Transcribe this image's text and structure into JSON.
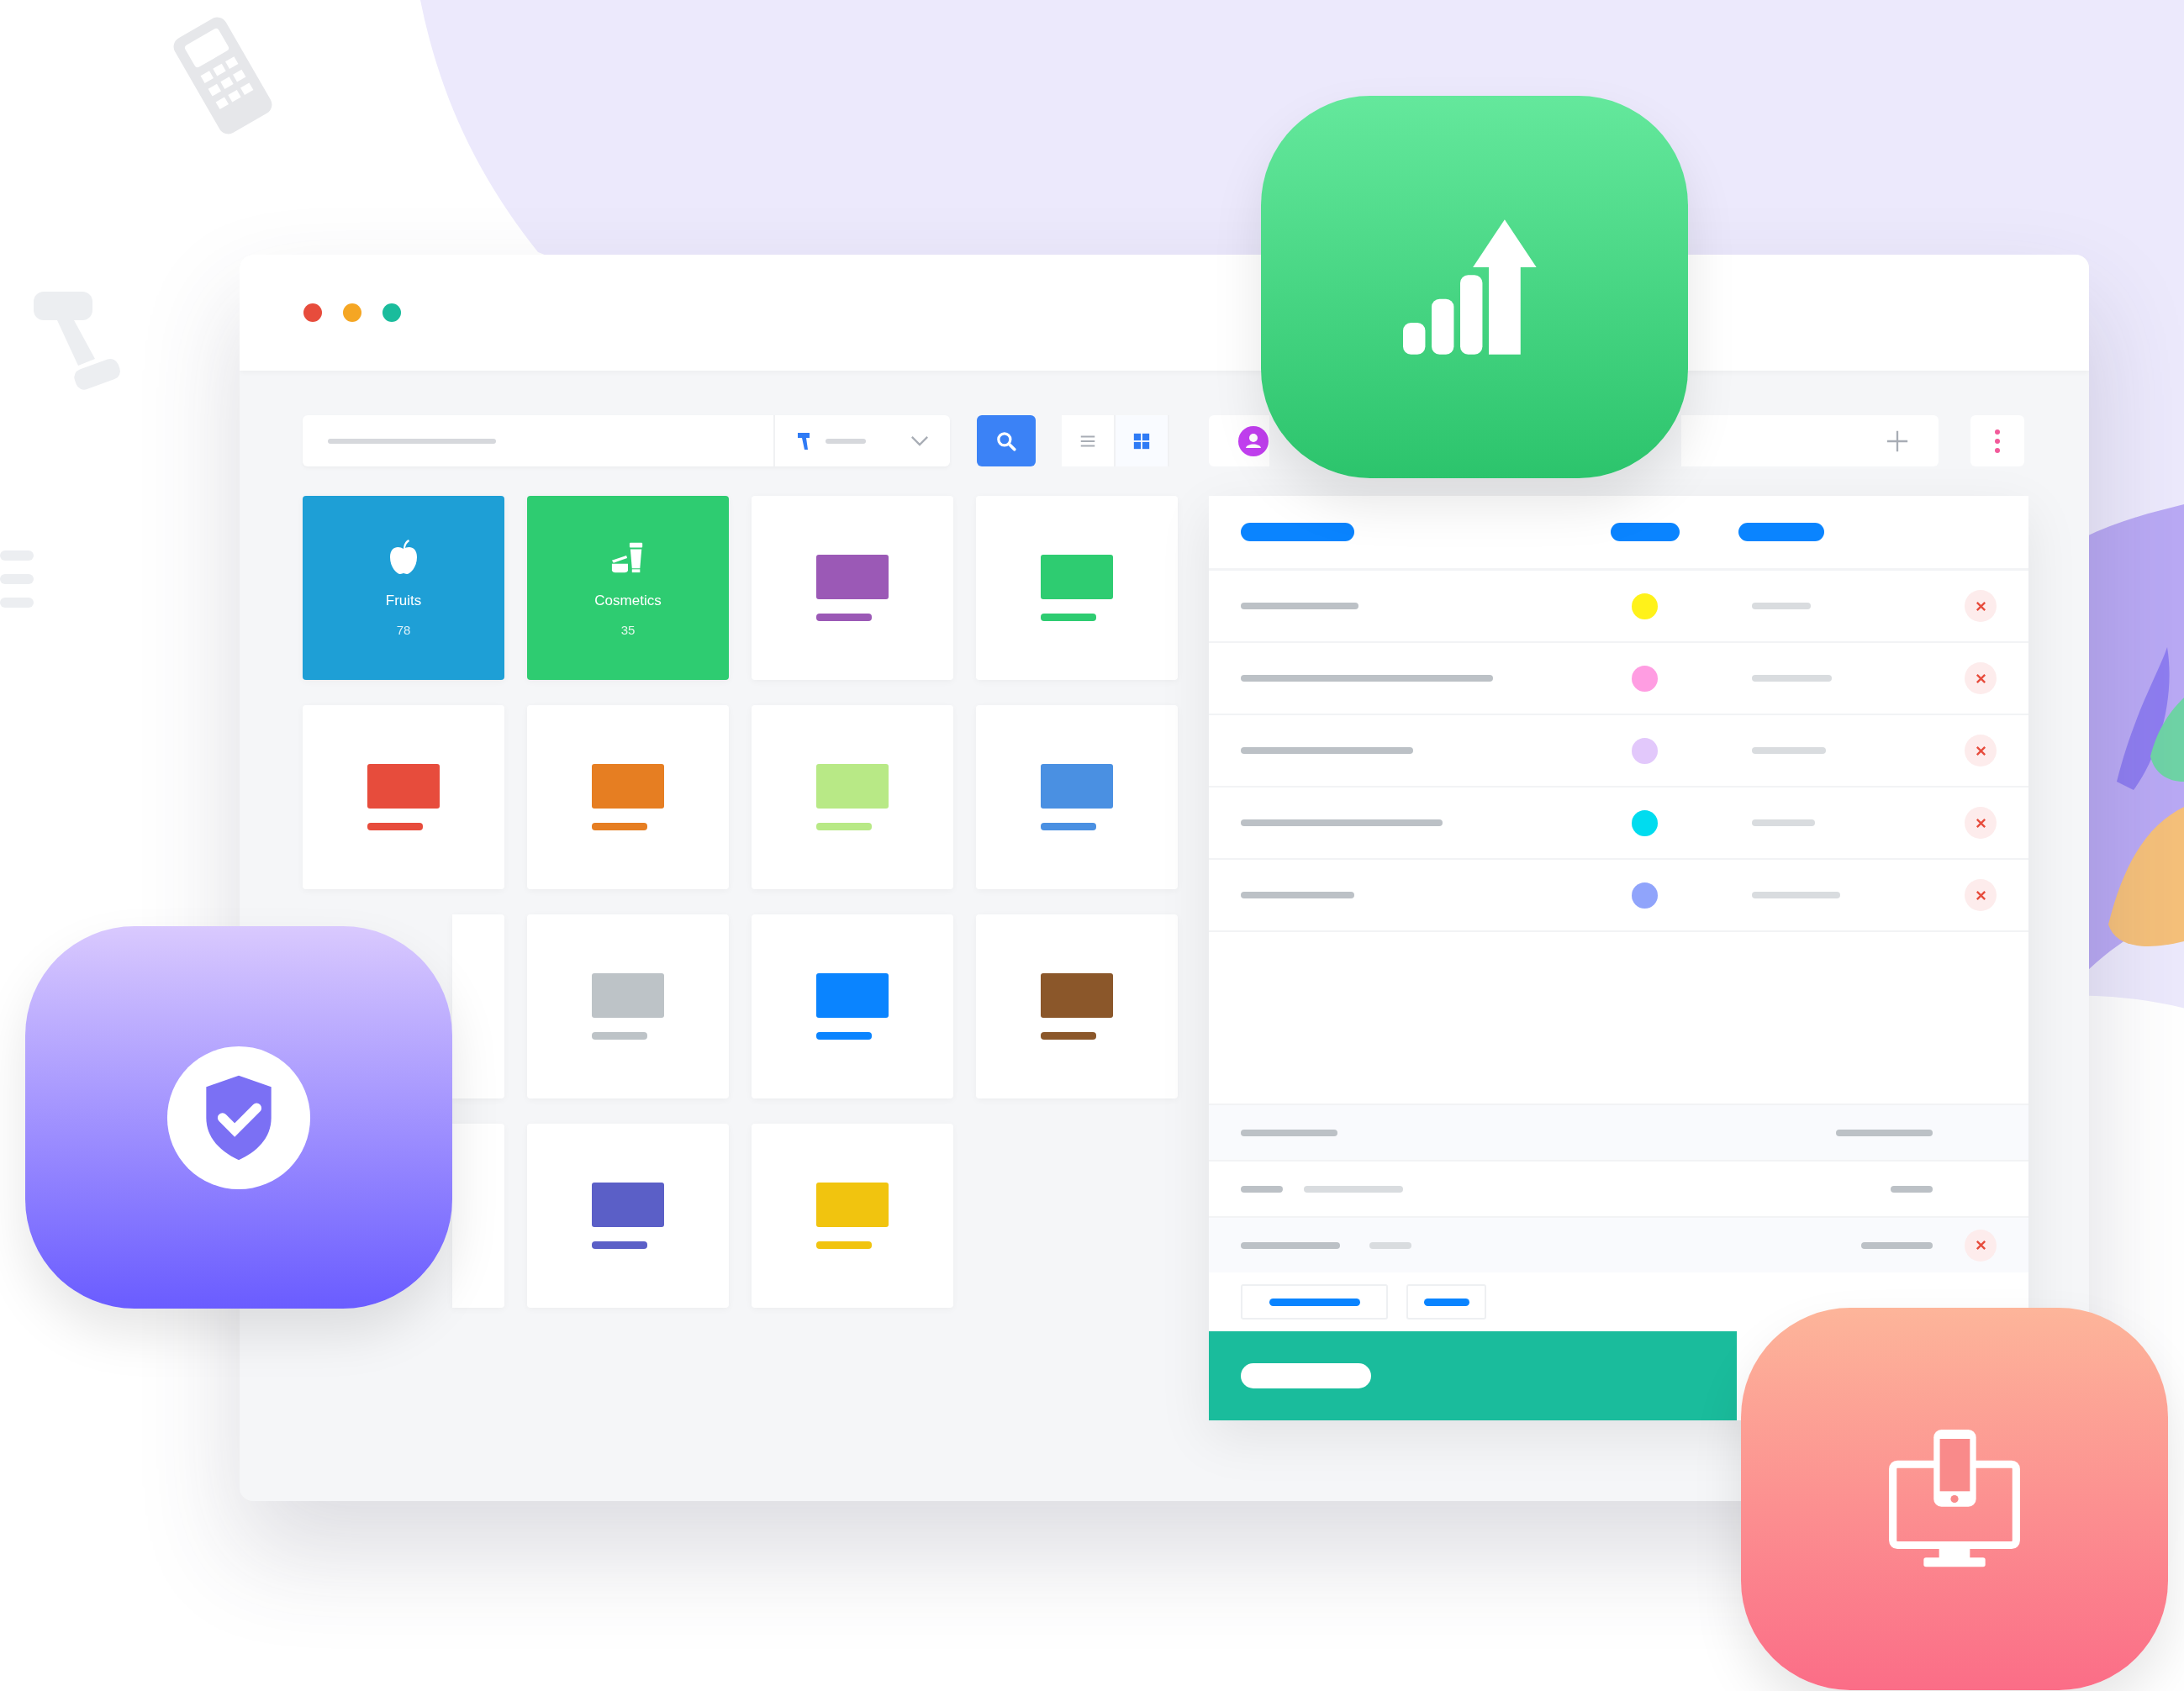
{
  "window": {
    "traffic_lights": [
      {
        "color": "#e74c3c"
      },
      {
        "color": "#f5a623"
      },
      {
        "color": "#1abc9c"
      }
    ]
  },
  "toolbar": {
    "view_modes": [
      {
        "kind": "list",
        "selected": false
      },
      {
        "kind": "grid",
        "selected": true
      }
    ]
  },
  "tiles": [
    {
      "kind": "category",
      "label": "Fruits",
      "count": "78",
      "color": "#1e9fd6"
    },
    {
      "kind": "category",
      "label": "Cosmetics",
      "count": "35",
      "color": "#2ecc71"
    },
    {
      "kind": "product",
      "color": "#9b59b6"
    },
    {
      "kind": "product",
      "color": "#2ecc71"
    },
    {
      "kind": "product",
      "color": "#e74c3c"
    },
    {
      "kind": "product",
      "color": "#e67e22"
    },
    {
      "kind": "product",
      "color": "#b8e986"
    },
    {
      "kind": "product",
      "color": "#4a90e2"
    },
    {
      "kind": "plain"
    },
    {
      "kind": "product",
      "color": "#bdc3c7"
    },
    {
      "kind": "product",
      "color": "#0a84ff"
    },
    {
      "kind": "product",
      "color": "#8b572a"
    },
    {
      "kind": "plain"
    },
    {
      "kind": "product",
      "color": "#5b5fc7"
    },
    {
      "kind": "product",
      "color": "#f1c40f"
    }
  ],
  "order_rows": [
    {
      "color": "#fff21a"
    },
    {
      "color": "#ff9de2"
    },
    {
      "color": "#e2c8fb"
    },
    {
      "color": "#00dcef"
    },
    {
      "color": "#90a4fb"
    }
  ],
  "summary_rows": [
    {
      "removable": false
    },
    {
      "removable": false
    },
    {
      "removable": true
    }
  ]
}
